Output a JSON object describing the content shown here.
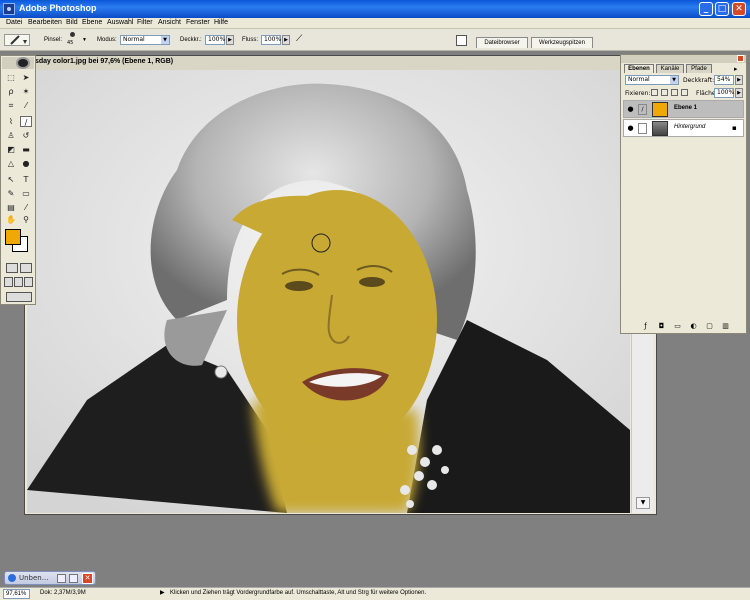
{
  "app": {
    "title": "Adobe Photoshop"
  },
  "window_buttons": {
    "minimize": "_",
    "maximize": "□",
    "close": "✕"
  },
  "menu": [
    "Datei",
    "Bearbeiten",
    "Bild",
    "Ebene",
    "Auswahl",
    "Filter",
    "Ansicht",
    "Fenster",
    "Hilfe"
  ],
  "options": {
    "pinsel_label": "Pinsel:",
    "pinsel_size": "45",
    "modus_label": "Modus:",
    "modus_value": "Normal",
    "deckkraft_label": "Deckkr.:",
    "deckkraft_value": "100%",
    "fluss_label": "Fluss:",
    "fluss_value": "100%",
    "tabs": [
      "Dateibrowser",
      "Werkzeugspitzen"
    ]
  },
  "document": {
    "title": "sday color1.jpg bei 97,6% (Ebene 1, RGB)",
    "hair_color": "#bdbdbd",
    "skin_overlay_color": "#c8a934"
  },
  "toolbox": {
    "foreground_color": "#f0a806",
    "background_color": "#ffffff"
  },
  "layers_panel": {
    "tabs": [
      "Ebenen",
      "Kanäle",
      "Pfade"
    ],
    "mode": "Normal",
    "opacity_label": "Deckkraft:",
    "opacity_value": "54%",
    "lock_label": "Fixieren:",
    "fill_label": "Fläche:",
    "fill_value": "100%",
    "layers": [
      {
        "name": "Ebene 1",
        "selected": true
      },
      {
        "name": "Hintergrund",
        "selected": false
      }
    ]
  },
  "minimized_doc": {
    "label": "Unben..."
  },
  "status": {
    "zoom": "97,61%",
    "info": "Dok: 2,37M/3,9M",
    "hint": "Klicken und Ziehen trägt Vordergrundfarbe auf. Umschalttaste, Alt und Strg für weitere Optionen."
  }
}
